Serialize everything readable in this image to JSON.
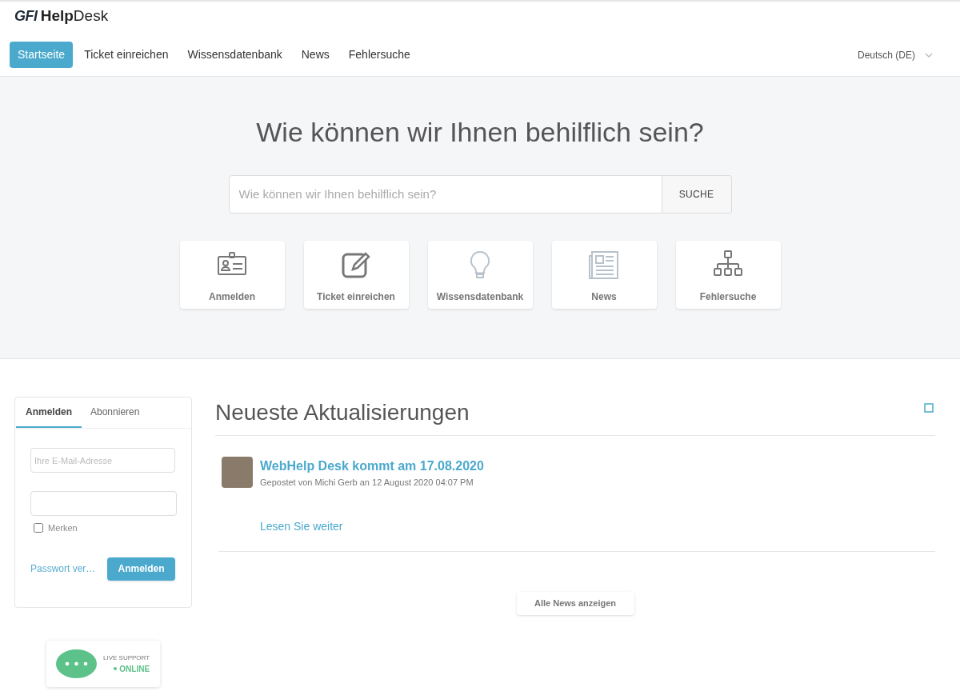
{
  "header": {
    "logo_brand": "GFI",
    "logo_product": "**Help**Desk"
  },
  "nav": [
    {
      "label": "Startseite",
      "selected": true
    },
    {
      "label": "Ticket einreichen",
      "selected": false
    },
    {
      "label": "Wissensdatenbank",
      "selected": false
    },
    {
      "label": "News",
      "selected": false
    },
    {
      "label": "Fehlersuche",
      "selected": false
    }
  ],
  "language": "Deutsch (DE)",
  "hero": {
    "title": "Wie können wir Ihnen behilflich sein?",
    "search": {
      "placeholder": "Wie können wir Ihnen behilflich sein?",
      "button": "SUCHE"
    },
    "tiles": [
      {
        "kind": "id-card",
        "label": "Anmelden"
      },
      {
        "kind": "edit",
        "label": "Ticket einreichen"
      },
      {
        "kind": "bulb",
        "label": "Wissensdatenbank"
      },
      {
        "kind": "newspaper",
        "label": "News"
      },
      {
        "kind": "tree",
        "label": "Fehlersuche"
      }
    ]
  },
  "login": {
    "tabs": [
      {
        "label": "Anmelden",
        "selected": true
      },
      {
        "label": "Abonnieren",
        "selected": false
      }
    ],
    "email": {
      "placeholder": "Ihre E-Mail-Adresse"
    },
    "remember": {
      "label": "Merken",
      "checked": false
    },
    "forgot": "Passwort ver…",
    "button": "Anmelden"
  },
  "live_support": {
    "title": "LIVE SUPPORT",
    "status": "ONLINE"
  },
  "updates": {
    "title": "Neueste Aktualisierungen",
    "posts": [
      {
        "title": "WebHelp Desk kommt am 17.08.2020",
        "meta": "Gepostet von Michi Gerb an 12 August 2020 04:07 PM",
        "link": "Lesen Sie weiter"
      }
    ],
    "all_button": "Alle News anzeigen"
  }
}
